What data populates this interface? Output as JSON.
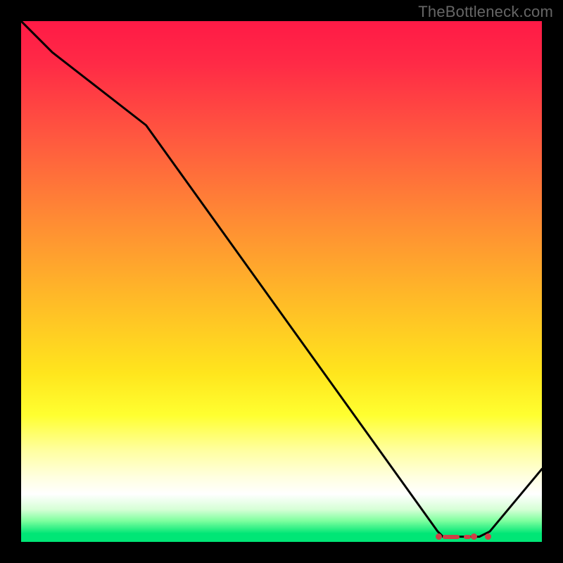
{
  "watermark": "TheBottleneck.com",
  "chart_data": {
    "type": "line",
    "title": "",
    "xlabel": "",
    "ylabel": "",
    "xlim": [
      0,
      100
    ],
    "ylim": [
      0,
      100
    ],
    "grid": false,
    "legend": false,
    "background_gradient": {
      "orientation": "vertical",
      "stops": [
        {
          "pos": 0.0,
          "color": "#ff1a46"
        },
        {
          "pos": 0.23,
          "color": "#ff5a3f"
        },
        {
          "pos": 0.53,
          "color": "#ffb828"
        },
        {
          "pos": 0.76,
          "color": "#ffff30"
        },
        {
          "pos": 0.88,
          "color": "#ffffe0"
        },
        {
          "pos": 0.98,
          "color": "#00e676"
        }
      ]
    },
    "series": [
      {
        "name": "bottleneck-curve",
        "x": [
          0,
          6,
          24,
          80,
          81,
          82,
          83,
          85,
          86,
          88,
          90,
          100
        ],
        "y": [
          100,
          94,
          80,
          2,
          1,
          1,
          1,
          1,
          1,
          1,
          2,
          14
        ],
        "color": "#000000"
      }
    ],
    "optimal_zone": {
      "x_start": 80,
      "x_end": 90,
      "y": 1,
      "marker_color": "#cf3f46"
    }
  }
}
